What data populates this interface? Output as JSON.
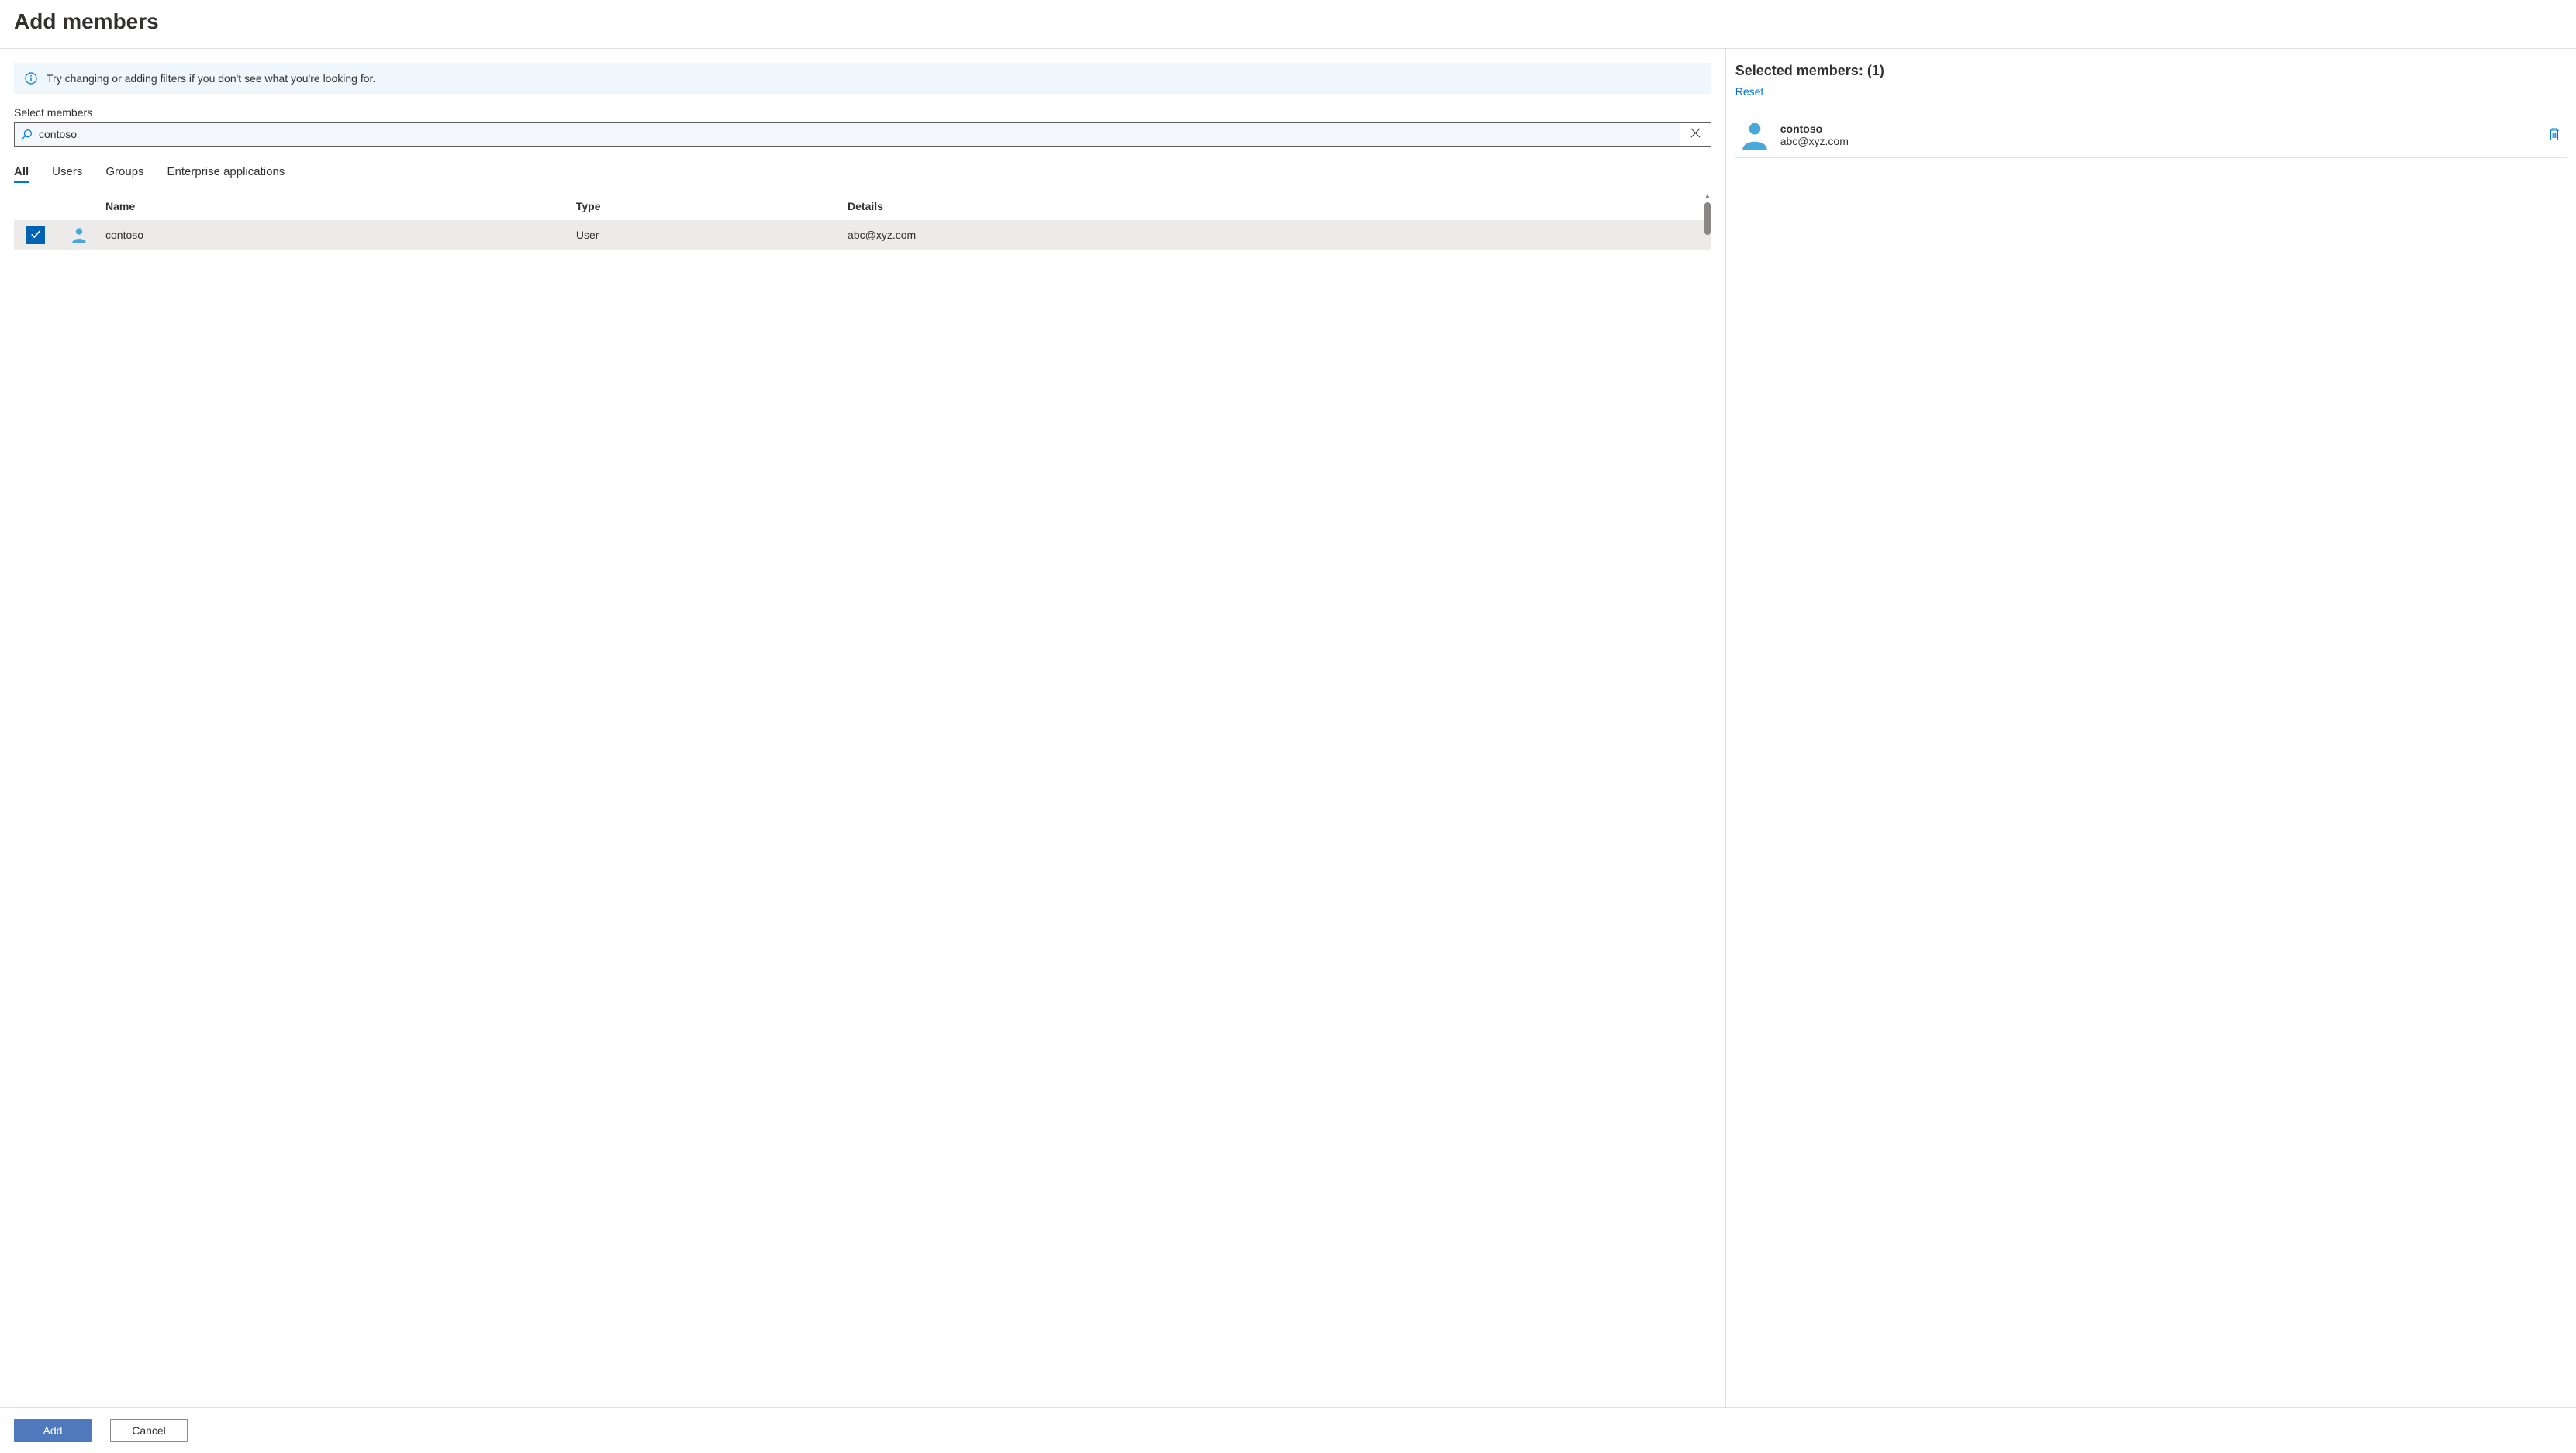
{
  "header": {
    "title": "Add members"
  },
  "info_banner": {
    "text": "Try changing or adding filters if you don't see what you're looking for."
  },
  "search": {
    "label": "Select members",
    "value": "contoso"
  },
  "tabs": {
    "items": [
      {
        "label": "All",
        "active": true
      },
      {
        "label": "Users",
        "active": false
      },
      {
        "label": "Groups",
        "active": false
      },
      {
        "label": "Enterprise applications",
        "active": false
      }
    ]
  },
  "table": {
    "columns": {
      "name": "Name",
      "type": "Type",
      "details": "Details"
    },
    "rows": [
      {
        "checked": true,
        "name": "contoso",
        "type": "User",
        "details": "abc@xyz.com"
      }
    ]
  },
  "selected": {
    "header_prefix": "Selected members:",
    "count": "(1)",
    "reset": "Reset",
    "items": [
      {
        "name": "contoso",
        "details": "abc@xyz.com"
      }
    ]
  },
  "footer": {
    "add": "Add",
    "cancel": "Cancel"
  }
}
